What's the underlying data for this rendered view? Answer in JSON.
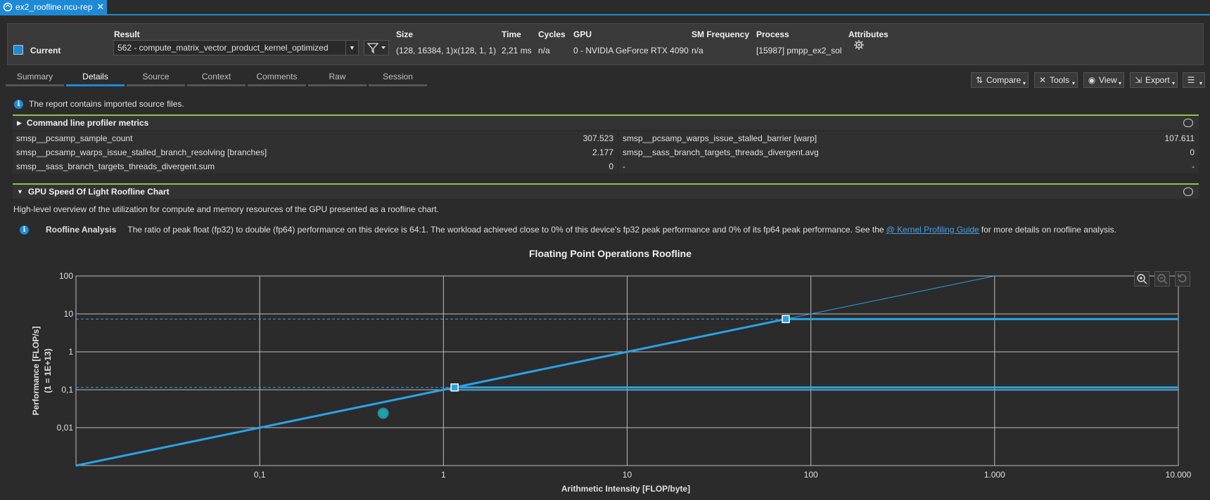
{
  "tab": {
    "filename": "ex2_roofline.ncu-rep"
  },
  "header": {
    "current_label": "Current",
    "result_label": "Result",
    "result_value": "562 - compute_matrix_vector_product_kernel_optimized",
    "size_label": "Size",
    "size_value": "(128, 16384, 1)x(128, 1, 1)",
    "time_label": "Time",
    "time_value": "2,21 ms",
    "cycles_label": "Cycles",
    "cycles_value": "n/a",
    "gpu_label": "GPU",
    "gpu_value": "0 - NVIDIA GeForce RTX 4090",
    "smfreq_label": "SM Frequency",
    "smfreq_value": "n/a",
    "process_label": "Process",
    "process_value": "[15987] pmpp_ex2_sol",
    "attributes_label": "Attributes"
  },
  "tabs": [
    "Summary",
    "Details",
    "Source",
    "Context",
    "Comments",
    "Raw",
    "Session"
  ],
  "active_tab": "Details",
  "toolbar": {
    "compare": "Compare",
    "tools": "Tools",
    "view": "View",
    "export": "Export"
  },
  "info_message": "The report contains imported source files.",
  "cmdline_section": {
    "title": "Command line profiler metrics",
    "rows": [
      {
        "left_name": "smsp__pcsamp_sample_count",
        "left_value": "307.523",
        "right_name": "smsp__pcsamp_warps_issue_stalled_barrier [warp]",
        "right_value": "107.611"
      },
      {
        "left_name": "smsp__pcsamp_warps_issue_stalled_branch_resolving [branches]",
        "left_value": "2.177",
        "right_name": "smsp__sass_branch_targets_threads_divergent.avg",
        "right_value": "0"
      },
      {
        "left_name": "smsp__sass_branch_targets_threads_divergent.sum",
        "left_value": "0",
        "right_name": "-",
        "right_value": "-"
      }
    ]
  },
  "sol_section": {
    "title": "GPU Speed Of Light Roofline Chart",
    "description": "High-level overview of the utilization for compute and memory resources of the GPU presented as a roofline chart.",
    "analysis_title": "Roofline Analysis",
    "analysis_text": "The ratio of peak float (fp32) to double (fp64) performance on this device is 64:1. The workload achieved close to 0% of this device's fp32 peak performance and 0% of its fp64 peak performance. See the",
    "link_text": "Kernel Profiling Guide",
    "analysis_suffix": "for more details on roofline analysis."
  },
  "chart_data": {
    "type": "scatter",
    "title": "Floating Point Operations Roofline",
    "xlabel": "Arithmetic Intensity [FLOP/byte]",
    "ylabel": "Performance [FLOP/s]",
    "ylabel_sub": "(1 = 1E+13)",
    "x_scale": "log",
    "y_scale": "log",
    "xlim": [
      0.01,
      10000
    ],
    "ylim": [
      0.001,
      100
    ],
    "x_ticks": [
      {
        "value": 0.1,
        "label": "0,1"
      },
      {
        "value": 1,
        "label": "1"
      },
      {
        "value": 10,
        "label": "10"
      },
      {
        "value": 100,
        "label": "100"
      },
      {
        "value": 1000,
        "label": "1.000"
      },
      {
        "value": 10000,
        "label": "10.000"
      }
    ],
    "y_ticks": [
      {
        "value": 100,
        "label": "100"
      },
      {
        "value": 10,
        "label": "10"
      },
      {
        "value": 1,
        "label": "1"
      },
      {
        "value": 0.1,
        "label": "0,1"
      },
      {
        "value": 0.01,
        "label": "0,01"
      }
    ],
    "bandwidth_line": {
      "from": [
        0.01,
        0.001
      ],
      "to": [
        1000,
        100
      ]
    },
    "rooflines": [
      {
        "name": "fp32",
        "peak": 7.3,
        "ridge": 73
      },
      {
        "name": "fp64",
        "peak": 0.115,
        "ridge": 1.15
      }
    ],
    "achieved_point": {
      "x": 0.47,
      "y": 0.024
    },
    "colors": {
      "roof": "#29a3e6",
      "point": "#1aa59a",
      "grid": "#bdbdbd"
    }
  }
}
